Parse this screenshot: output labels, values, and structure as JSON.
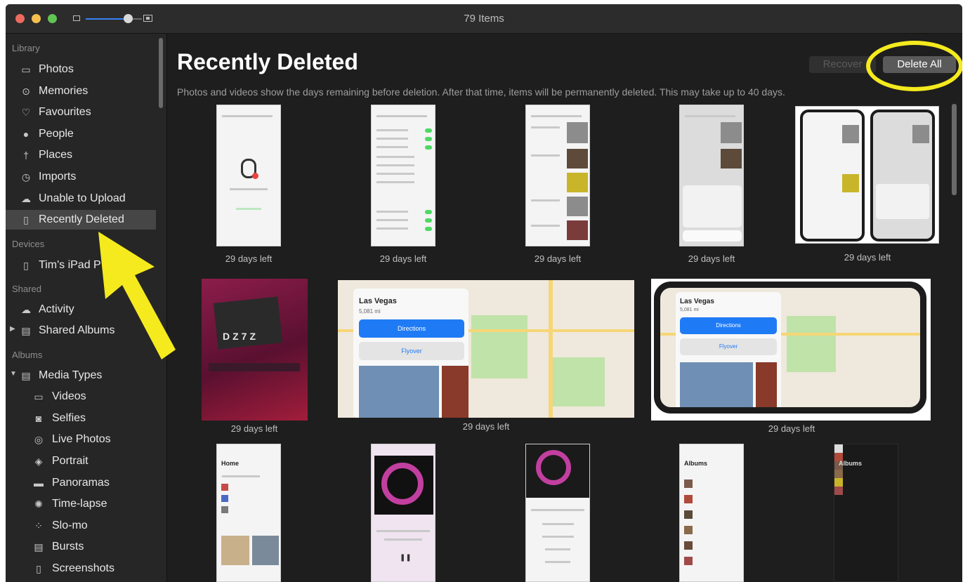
{
  "window": {
    "title": "79 Items"
  },
  "sidebar": {
    "sections": [
      {
        "label": "Library"
      },
      {
        "label": "Devices"
      },
      {
        "label": "Shared"
      },
      {
        "label": "Albums"
      }
    ],
    "items": [
      {
        "label": "Photos",
        "icon": "photos-icon"
      },
      {
        "label": "Memories",
        "icon": "memories-icon"
      },
      {
        "label": "Favourites",
        "icon": "heart-icon"
      },
      {
        "label": "People",
        "icon": "person-icon"
      },
      {
        "label": "Places",
        "icon": "pin-icon"
      },
      {
        "label": "Imports",
        "icon": "clock-icon"
      },
      {
        "label": "Unable to Upload",
        "icon": "cloud-warning-icon"
      },
      {
        "label": "Recently Deleted",
        "icon": "trash-icon",
        "selected": true
      },
      {
        "label": "Tim's iPad P",
        "icon": "ipad-icon"
      },
      {
        "label": "Activity",
        "icon": "cloud-icon"
      },
      {
        "label": "Shared Albums",
        "icon": "shared-album-icon"
      },
      {
        "label": "Media Types",
        "icon": "folder-icon"
      },
      {
        "label": "Videos",
        "icon": "video-icon"
      },
      {
        "label": "Selfies",
        "icon": "camera-icon"
      },
      {
        "label": "Live Photos",
        "icon": "live-photo-icon"
      },
      {
        "label": "Portrait",
        "icon": "cube-icon"
      },
      {
        "label": "Panoramas",
        "icon": "panorama-icon"
      },
      {
        "label": "Time-lapse",
        "icon": "timelapse-icon"
      },
      {
        "label": "Slo-mo",
        "icon": "slomo-icon"
      },
      {
        "label": "Bursts",
        "icon": "bursts-icon"
      },
      {
        "label": "Screenshots",
        "icon": "screenshot-icon"
      }
    ]
  },
  "main": {
    "title": "Recently Deleted",
    "subtitle": "Photos and videos show the days remaining before deletion. After that time, items will be permanently deleted. This may take up to 40 days.",
    "recover_label": "Recover",
    "delete_all_label": "Delete All",
    "days_left": "29 days left",
    "map_city": "Las Vegas",
    "map_distance": "5,081 mi",
    "map_directions": "Directions",
    "map_flyover": "Flyover"
  },
  "zoom": {
    "level": 0.75
  },
  "colors": {
    "highlight": "#f4ea1e",
    "selected_row": "#464646",
    "accent": "#3a82f7"
  }
}
